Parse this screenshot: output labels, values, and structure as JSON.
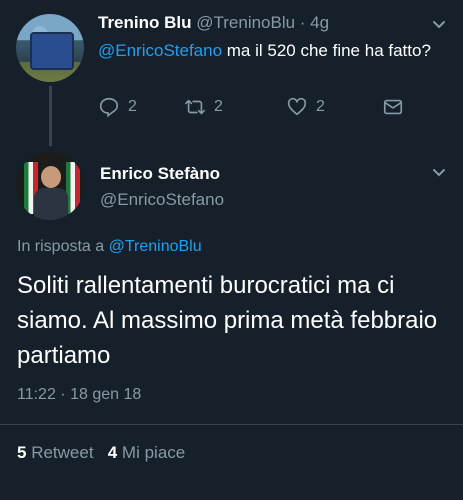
{
  "parent": {
    "display_name": "Trenino Blu",
    "handle": "@TreninoBlu",
    "separator_age": " · 4g",
    "mention": "@EnricoStefano",
    "text": " ma il 520 che fine ha fatto?",
    "reply_count": "2",
    "retweet_count": "2",
    "like_count": "2"
  },
  "main": {
    "display_name": "Enrico Stefàno",
    "handle": "@EnricoStefano",
    "reply_prefix": "In risposta a ",
    "reply_to": "@TreninoBlu",
    "text": "Soliti rallentamenti burocratici ma ci siamo. Al massimo prima metà febbraio partiamo",
    "timestamp": "11:22 · 18 gen 18",
    "retweets_count": "5",
    "retweets_label": " Retweet",
    "likes_count": "4",
    "likes_label": " Mi piace"
  },
  "colors": {
    "background": "#15202b",
    "link": "#1da1f2",
    "muted": "#8899a6"
  }
}
